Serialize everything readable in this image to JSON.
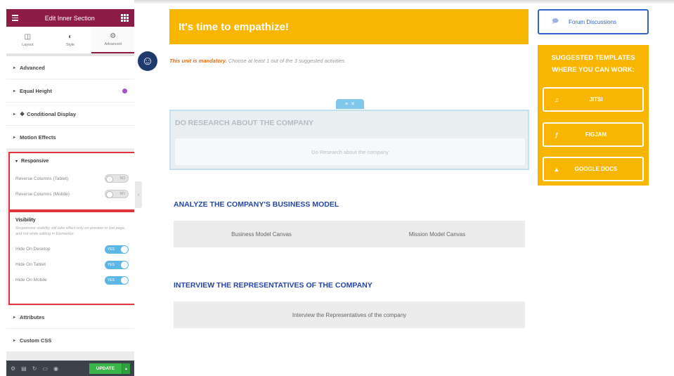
{
  "panel": {
    "title": "Edit Inner Section",
    "tabs": [
      {
        "label": "Layout",
        "icon": "layout-icon"
      },
      {
        "label": "Style",
        "icon": "style-icon"
      },
      {
        "label": "Advanced",
        "icon": "gear-icon",
        "active": true
      }
    ],
    "sections": {
      "advanced": "Advanced",
      "equal_height": "Equal Height",
      "conditional_display": "Conditional Display",
      "motion_effects": "Motion Effects",
      "attributes": "Attributes",
      "custom_css": "Custom CSS"
    },
    "responsive": {
      "title": "Responsive",
      "reverse_tablet": {
        "label": "Reverse Columns (Tablet)",
        "state": "NO"
      },
      "reverse_mobile": {
        "label": "Reverse Columns (Mobile)",
        "state": "NO"
      }
    },
    "visibility": {
      "title": "Visibility",
      "description": "Responsive visibility will take effect only on preview or live page, and not while editing in Elementor.",
      "hide_desktop": {
        "label": "Hide On Desktop",
        "state": "YES"
      },
      "hide_tablet": {
        "label": "Hide On Tablet",
        "state": "YES"
      },
      "hide_mobile": {
        "label": "Hide On Mobile",
        "state": "YES"
      }
    },
    "footer": {
      "update_label": "UPDATE"
    }
  },
  "main": {
    "banner": "It's time to empathize!",
    "mandatory": {
      "highlight": "This unit is mandatory.",
      "rest": " Choose at least 1 out of the 3 suggested activities."
    },
    "research": {
      "title": "DO RESEARCH ABOUT THE COMPANY",
      "item": "Do Research about the company"
    },
    "analyze": {
      "title": "ANALYZE THE COMPANY'S BUSINESS MODEL",
      "items": [
        "Business Model Canvas",
        "Mission Model Canvas"
      ]
    },
    "interview": {
      "title": "INTERVIEW THE REPRESENTATIVES OF THE COMPANY",
      "item": "Interview the Representatives of the company"
    }
  },
  "sidebar": {
    "forum_label": "Forum Discussions",
    "templates_title_1": "SUGGESTED TEMPLATES",
    "templates_title_2": "WHERE YOU CAN WORK:",
    "templates": [
      "JITSI",
      "FIGJAM",
      "GOOGLE DOCS"
    ]
  },
  "colors": {
    "panel_header": "#8c1c46",
    "accent_yellow": "#f8b600",
    "heading_blue": "#2446a6",
    "highlight_red": "#e0343d",
    "toggle_on": "#5bb7e5"
  }
}
